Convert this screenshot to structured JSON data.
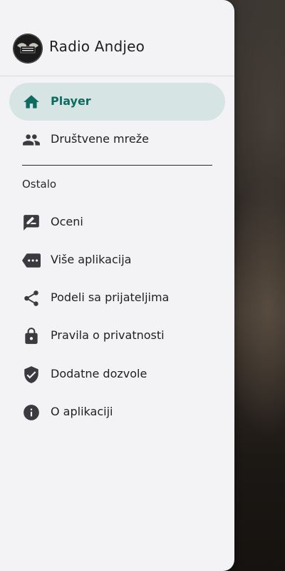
{
  "app": {
    "title": "Radio Andjeo",
    "logo_text": "RADIO ANDJEO"
  },
  "nav": {
    "items": [
      {
        "label": "Player",
        "icon": "home-icon",
        "active": true
      },
      {
        "label": "Društvene mreže",
        "icon": "people-icon"
      }
    ]
  },
  "section_label": "Ostalo",
  "other": {
    "items": [
      {
        "label": "Oceni",
        "icon": "rate-review-icon"
      },
      {
        "label": "Više aplikacija",
        "icon": "more-apps-tag-icon"
      },
      {
        "label": "Podeli sa prijateljima",
        "icon": "share-icon"
      },
      {
        "label": "Pravila o privatnosti",
        "icon": "lock-icon"
      },
      {
        "label": "Dodatne dozvole",
        "icon": "shield-check-icon"
      },
      {
        "label": "O aplikaciji",
        "icon": "info-icon"
      }
    ]
  },
  "colors": {
    "accent": "#0e6b60",
    "active_bg": "#d6e5e4",
    "drawer_bg": "#f3f3f5",
    "icon": "#3a3a3f"
  }
}
